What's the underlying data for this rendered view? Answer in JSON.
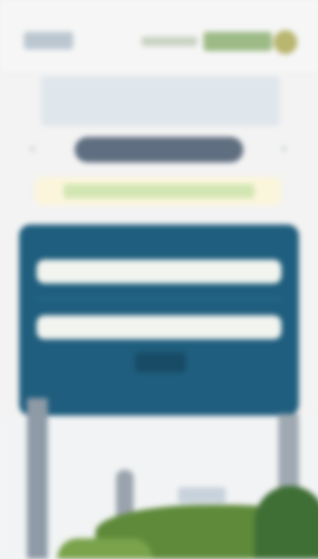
{
  "header": {
    "logo_left_icon": "site-logo-icon",
    "brand_text": "",
    "seal_icon": "brand-seal-icon"
  },
  "headline": "",
  "nav": {
    "prev_icon": "chevron-left-icon",
    "next_icon": "chevron-right-icon",
    "button_label": ""
  },
  "notice": {
    "text": ""
  },
  "search_panel": {
    "title": "",
    "field1": {
      "label": "",
      "value": "",
      "placeholder": ""
    },
    "field2": {
      "label": "",
      "value": "",
      "placeholder": ""
    },
    "button_label": "",
    "footer_text": ""
  },
  "colors": {
    "panel": "#1f5e7e",
    "pill_button": "#5f6e80",
    "notice_bg": "#fbf5dc",
    "notice_text_bg": "#d2e6b3",
    "headline_text": "#5b7f98"
  }
}
